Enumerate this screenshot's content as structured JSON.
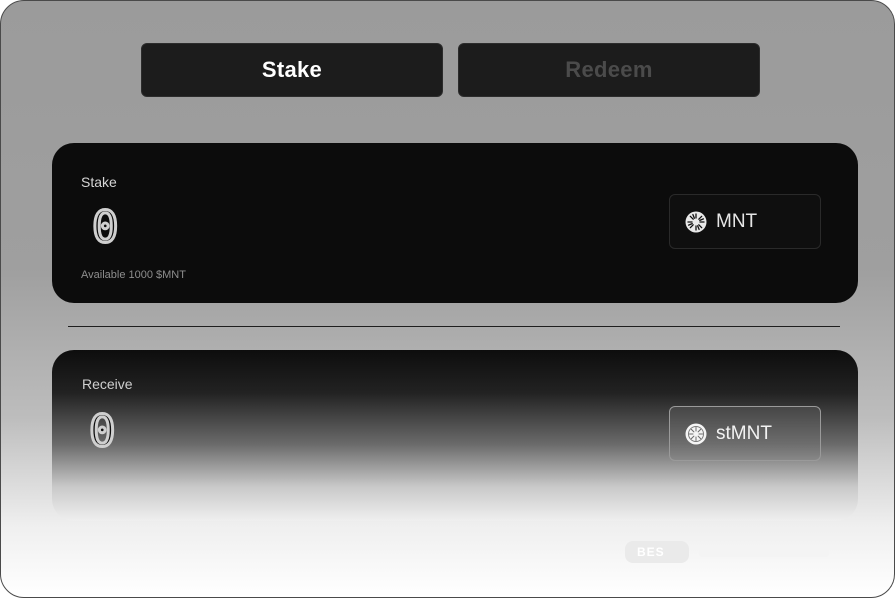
{
  "tabs": {
    "stake_label": "Stake",
    "redeem_label": "Redeem"
  },
  "stake_card": {
    "label": "Stake",
    "amount": "0",
    "available": "Available 1000 $MNT",
    "token": "MNT",
    "token_icon": "mantle-icon"
  },
  "receive_card": {
    "label": "Receive",
    "amount": "0",
    "token": "stMNT",
    "token_icon": "stmnt-icon"
  },
  "footer": {
    "badge": "BES"
  },
  "colors": {
    "card_bg": "#0c0c0c",
    "active_tab_text": "#ffffff",
    "inactive_tab_text": "#4b4b4b"
  }
}
